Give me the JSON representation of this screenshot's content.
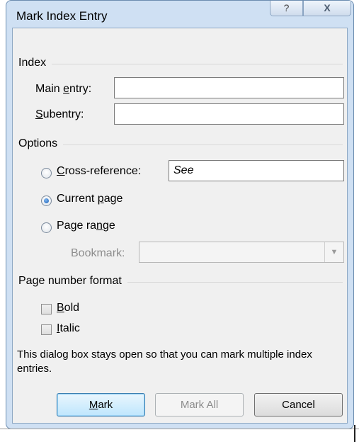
{
  "window": {
    "title": "Mark Index Entry",
    "help_glyph": "?",
    "close_glyph": "X"
  },
  "index": {
    "section_label": "Index",
    "main_entry": {
      "pre": "Main ",
      "accel": "e",
      "post": "ntry:",
      "value": ""
    },
    "subentry": {
      "pre": "",
      "accel": "S",
      "post": "ubentry:",
      "value": ""
    }
  },
  "options": {
    "section_label": "Options",
    "cross_reference": {
      "pre": "",
      "accel": "C",
      "post": "ross-reference:",
      "checked": false,
      "value": "See"
    },
    "current_page": {
      "pre": "Current ",
      "accel": "p",
      "post": "age",
      "checked": true
    },
    "page_range": {
      "pre": "Page ra",
      "accel": "n",
      "post": "ge",
      "checked": false
    },
    "bookmark": {
      "label": "Bookmark:",
      "value": ""
    }
  },
  "page_number_format": {
    "section_label": "Page number format",
    "bold": {
      "pre": "",
      "accel": "B",
      "post": "old",
      "checked": false
    },
    "italic": {
      "pre": "",
      "accel": "I",
      "post": "talic",
      "checked": false
    }
  },
  "note": "This dialog box stays open so that you can mark multiple index entries.",
  "buttons": {
    "mark": {
      "pre": "",
      "accel": "M",
      "post": "ark"
    },
    "mark_all": "Mark All",
    "cancel": "Cancel"
  }
}
